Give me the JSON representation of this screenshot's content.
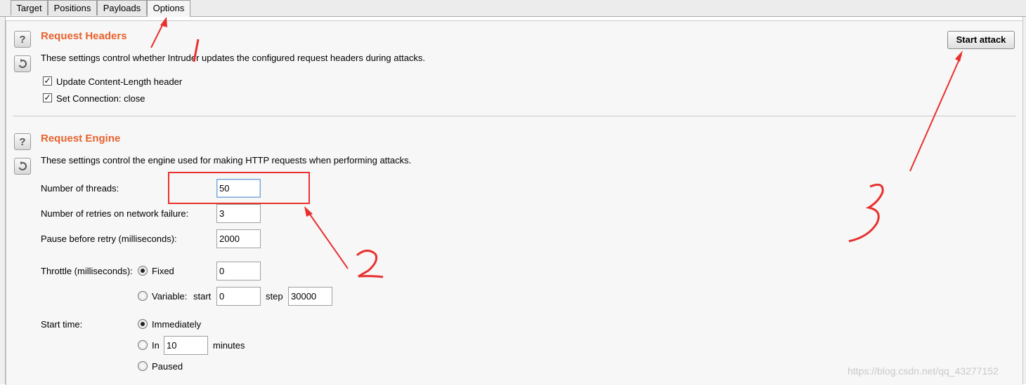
{
  "tabs": [
    {
      "label": "Target"
    },
    {
      "label": "Positions"
    },
    {
      "label": "Payloads"
    },
    {
      "label": "Options",
      "active": true
    }
  ],
  "request_headers": {
    "title": "Request Headers",
    "description": "These settings control whether Intruder updates the configured request headers during attacks.",
    "options": [
      {
        "label": "Update Content-Length header",
        "checked": true
      },
      {
        "label": "Set Connection: close",
        "checked": true
      }
    ]
  },
  "start_attack": {
    "label": "Start attack"
  },
  "request_engine": {
    "title": "Request Engine",
    "description": "These settings control the engine used for making HTTP requests when performing attacks.",
    "threads_label": "Number of threads:",
    "threads_value": "50",
    "retries_label": "Number of retries on network failure:",
    "retries_value": "3",
    "pause_label": "Pause before retry (milliseconds):",
    "pause_value": "2000",
    "throttle_label": "Throttle (milliseconds):",
    "throttle_fixed_label": "Fixed",
    "throttle_fixed_value": "0",
    "throttle_fixed_selected": true,
    "throttle_variable_label": "Variable:",
    "throttle_start_label": "start",
    "throttle_start_value": "0",
    "throttle_step_label": "step",
    "throttle_step_value": "30000",
    "start_time_label": "Start time:",
    "start_immediately_label": "Immediately",
    "start_immediately_selected": true,
    "start_in_label": "In",
    "start_in_value": "10",
    "start_in_unit": "minutes",
    "start_paused_label": "Paused"
  },
  "annotations": {
    "label_1": "1",
    "label_2": "2",
    "label_3": "3",
    "color": "#e8312f"
  },
  "watermark": "https://blog.csdn.net/qq_43277152",
  "icons": {
    "help": "question-mark-icon",
    "reset": "refresh-icon"
  }
}
